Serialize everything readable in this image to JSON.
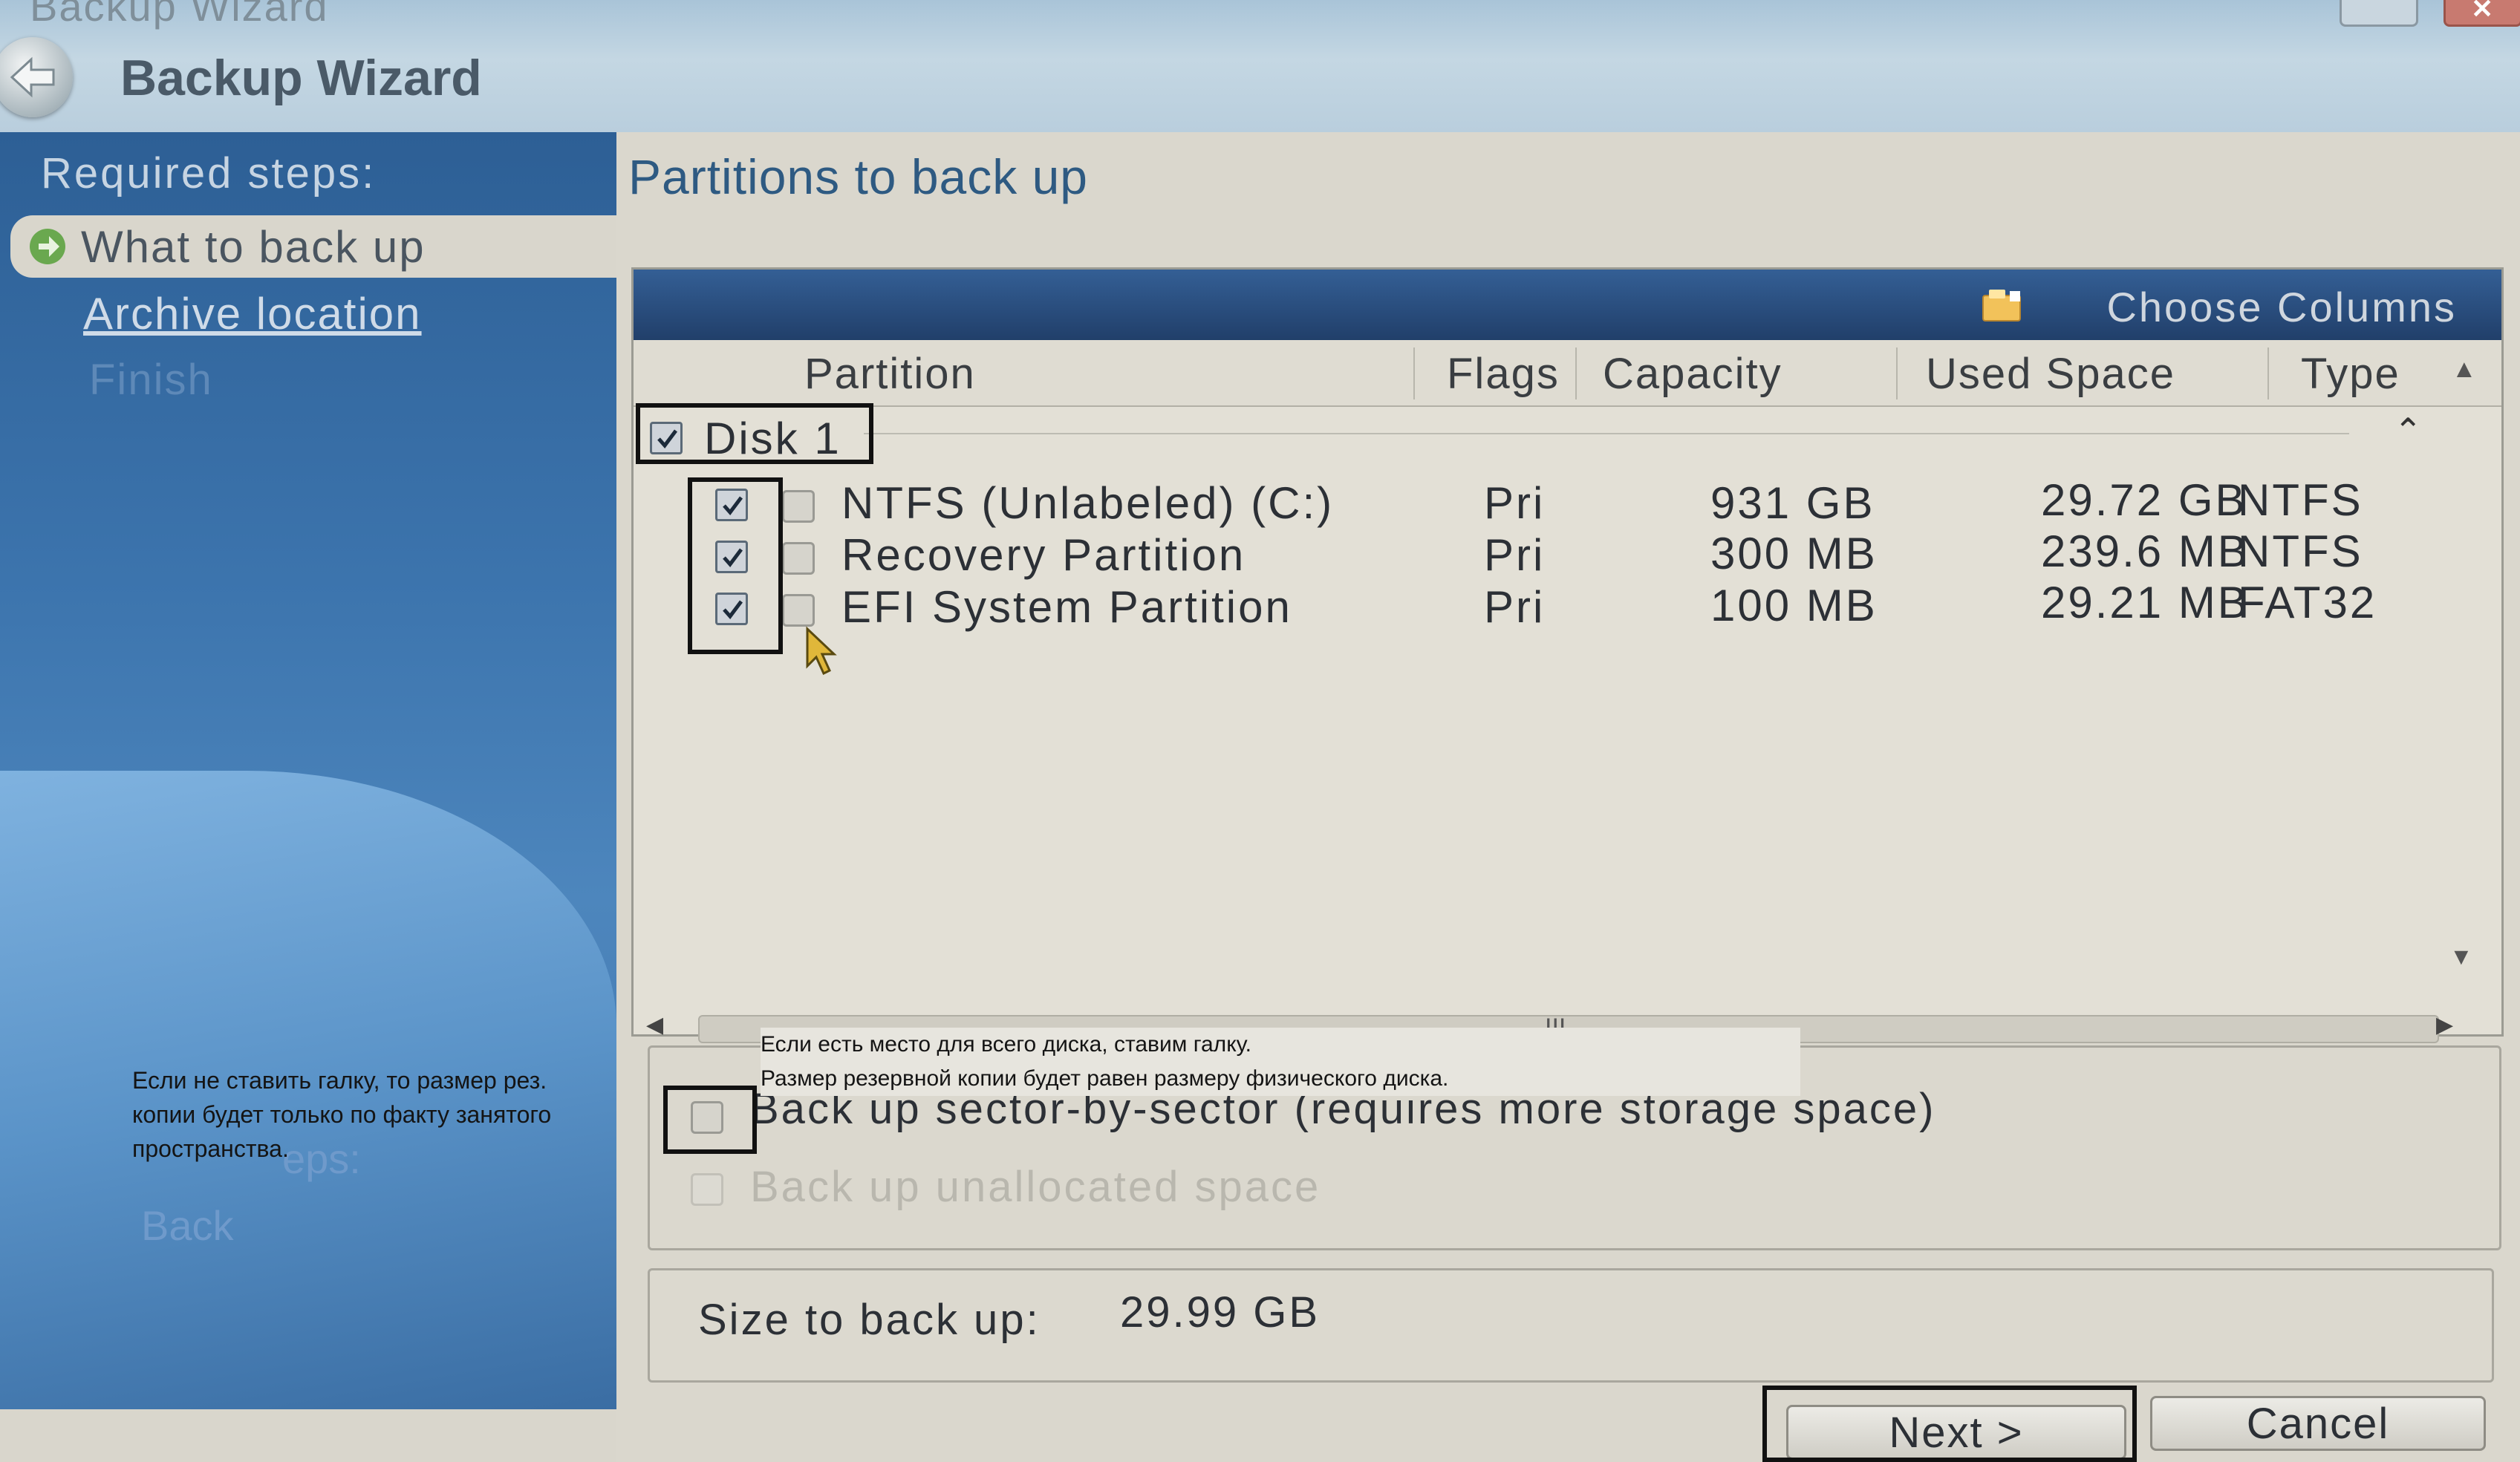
{
  "window": {
    "ghost_title": "Backup Wizard",
    "title": "Backup Wizard",
    "close_glyph": "✕"
  },
  "sidebar": {
    "header": "Required steps:",
    "steps": [
      {
        "label": "What to back up",
        "state": "current"
      },
      {
        "label": "Archive location",
        "state": "link"
      },
      {
        "label": "Finish",
        "state": "disabled"
      }
    ],
    "ghost_text_1": "eps:",
    "ghost_text_2": "Back"
  },
  "annotations": {
    "left_note": "Если не ставить галку, то размер рез. копии будет только по факту занятого пространства.",
    "right_note_line1": "Если есть место для всего диска, ставим галку.",
    "right_note_line2": "Размер резервной копии будет равен размеру физического диска."
  },
  "main": {
    "title": "Partitions to back up",
    "toolbar": {
      "choose_columns": "Choose Columns",
      "icon": "choose-columns-icon"
    },
    "columns": [
      "Partition",
      "Flags",
      "Capacity",
      "Used Space",
      "Type"
    ],
    "disk": {
      "label": "Disk 1",
      "checked": true
    },
    "partitions": [
      {
        "name": "NTFS (Unlabeled) (C:)",
        "flags": "Pri",
        "capacity": "931 GB",
        "used": "29.72 GB",
        "type": "NTFS",
        "checked": true
      },
      {
        "name": "Recovery Partition",
        "flags": "Pri",
        "capacity": "300 MB",
        "used": "239.6 MB",
        "type": "NTFS",
        "checked": true
      },
      {
        "name": "EFI System Partition",
        "flags": "Pri",
        "capacity": "100 MB",
        "used": "29.21 MB",
        "type": "FAT32",
        "checked": true
      }
    ],
    "scroll_grip": "III",
    "options": {
      "sector_by_sector": {
        "label": "Back up sector-by-sector (requires more storage space)",
        "checked": false
      },
      "unallocated": {
        "label": "Back up unallocated space",
        "checked": false,
        "enabled": false
      }
    },
    "size": {
      "label": "Size to back up:",
      "value": "29.99 GB"
    }
  },
  "buttons": {
    "next": "Next >",
    "cancel": "Cancel"
  },
  "colors": {
    "sidebar": "#3c74ad",
    "toolbar": "#2a4d7e",
    "title_accent": "#2e5a82",
    "highlight_box": "#111111"
  }
}
